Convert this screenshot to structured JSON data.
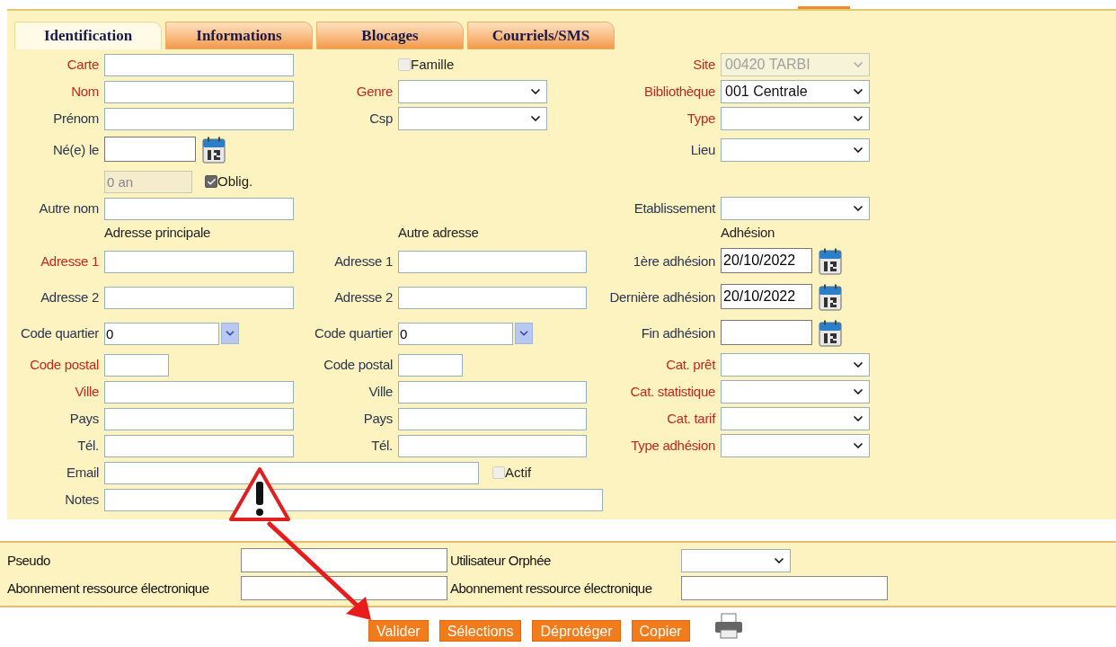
{
  "tabs": [
    {
      "label": "Identification",
      "selected": true
    },
    {
      "label": "Informations",
      "selected": false
    },
    {
      "label": "Blocages",
      "selected": false
    },
    {
      "label": "Courriels/SMS",
      "selected": false
    }
  ],
  "rows": [
    {
      "cells": [
        {
          "kind": "text",
          "label": "Carte",
          "required": true
        },
        {
          "kind": "checkbox",
          "label": "Famille",
          "checked": false,
          "disabled": true
        },
        {
          "kind": "select",
          "label": "Site",
          "required": true,
          "value": "00420 TARBI",
          "disabled": true
        }
      ]
    },
    {
      "cells": [
        {
          "kind": "text",
          "label": "Nom",
          "required": true
        },
        {
          "kind": "select",
          "label": "Genre",
          "required": true
        },
        {
          "kind": "select",
          "label": "Bibliothèque",
          "required": true,
          "value": "001 Centrale",
          "disabled": false
        }
      ]
    },
    {
      "cells": [
        {
          "kind": "text",
          "label": "Prénom",
          "required": false
        },
        {
          "kind": "select",
          "label": "Csp",
          "required": false
        },
        {
          "kind": "select",
          "label": "Type",
          "required": true
        }
      ]
    },
    {
      "cells": [
        {
          "kind": "date",
          "label": "Né(e) le",
          "required": false
        },
        null,
        {
          "kind": "select",
          "label": "Lieu",
          "required": false
        }
      ]
    },
    {
      "cells": [
        {
          "kind": "age",
          "value": "0 an",
          "disabled": true,
          "check_label": "Oblig.",
          "checked": true
        },
        null,
        null
      ]
    },
    {
      "cells": [
        {
          "kind": "text",
          "label": "Autre nom",
          "required": false
        },
        null,
        {
          "kind": "select",
          "label": "Etablissement",
          "required": false
        }
      ]
    },
    {
      "cells": [
        {
          "kind": "heading",
          "text": "Adresse principale"
        },
        {
          "kind": "heading",
          "text": "Autre adresse"
        },
        {
          "kind": "heading",
          "text": "Adhésion"
        }
      ]
    },
    {
      "cells": [
        {
          "kind": "text",
          "label": "Adresse 1",
          "required": true
        },
        {
          "kind": "text",
          "label": "Adresse 1",
          "required": false
        },
        {
          "kind": "date",
          "label": "1ère adhésion",
          "required": false,
          "value": "20/10/2022"
        }
      ]
    },
    {
      "cells": [
        {
          "kind": "text",
          "label": "Adresse 2",
          "required": false
        },
        {
          "kind": "text",
          "label": "Adresse 2",
          "required": false
        },
        {
          "kind": "date",
          "label": "Dernière adhésion",
          "required": false,
          "value": "20/10/2022"
        }
      ]
    },
    {
      "cells": [
        {
          "kind": "combo",
          "label": "Code quartier",
          "required": false,
          "value": "0"
        },
        {
          "kind": "combo",
          "label": "Code quartier",
          "required": false,
          "value": "0"
        },
        {
          "kind": "date",
          "label": "Fin adhésion",
          "required": false
        }
      ]
    },
    {
      "cells": [
        {
          "kind": "postal",
          "label": "Code postal",
          "required": true
        },
        {
          "kind": "postal",
          "label": "Code postal",
          "required": false
        },
        {
          "kind": "select",
          "label": "Cat. prêt",
          "required": true
        }
      ]
    },
    {
      "cells": [
        {
          "kind": "text",
          "label": "Ville",
          "required": true
        },
        {
          "kind": "text",
          "label": "Ville",
          "required": false
        },
        {
          "kind": "select",
          "label": "Cat. statistique",
          "required": true
        }
      ]
    },
    {
      "cells": [
        {
          "kind": "text",
          "label": "Pays",
          "required": false
        },
        {
          "kind": "text",
          "label": "Pays",
          "required": false
        },
        {
          "kind": "select",
          "label": "Cat. tarif",
          "required": true
        }
      ]
    },
    {
      "cells": [
        {
          "kind": "text",
          "label": "Tél.",
          "required": false
        },
        {
          "kind": "text",
          "label": "Tél.",
          "required": false
        },
        {
          "kind": "select",
          "label": "Type adhésion",
          "required": true
        }
      ]
    }
  ],
  "wide_rows": [
    {
      "label": "Email",
      "checkbox": {
        "label": "Actif",
        "checked": false,
        "disabled": true
      }
    },
    {
      "label": "Notes"
    }
  ],
  "account_rows": [
    {
      "cells": [
        {
          "kind": "text",
          "label": "Pseudo"
        },
        {
          "kind": "select",
          "label": "Utilisateur Orphée"
        }
      ]
    },
    {
      "cells": [
        {
          "kind": "text",
          "label": "Abonnement ressource électronique"
        },
        {
          "kind": "text",
          "label": "Abonnement ressource électronique"
        }
      ]
    }
  ],
  "buttons": [
    "Valider",
    "Sélections",
    "Déprotéger",
    "Copier"
  ]
}
